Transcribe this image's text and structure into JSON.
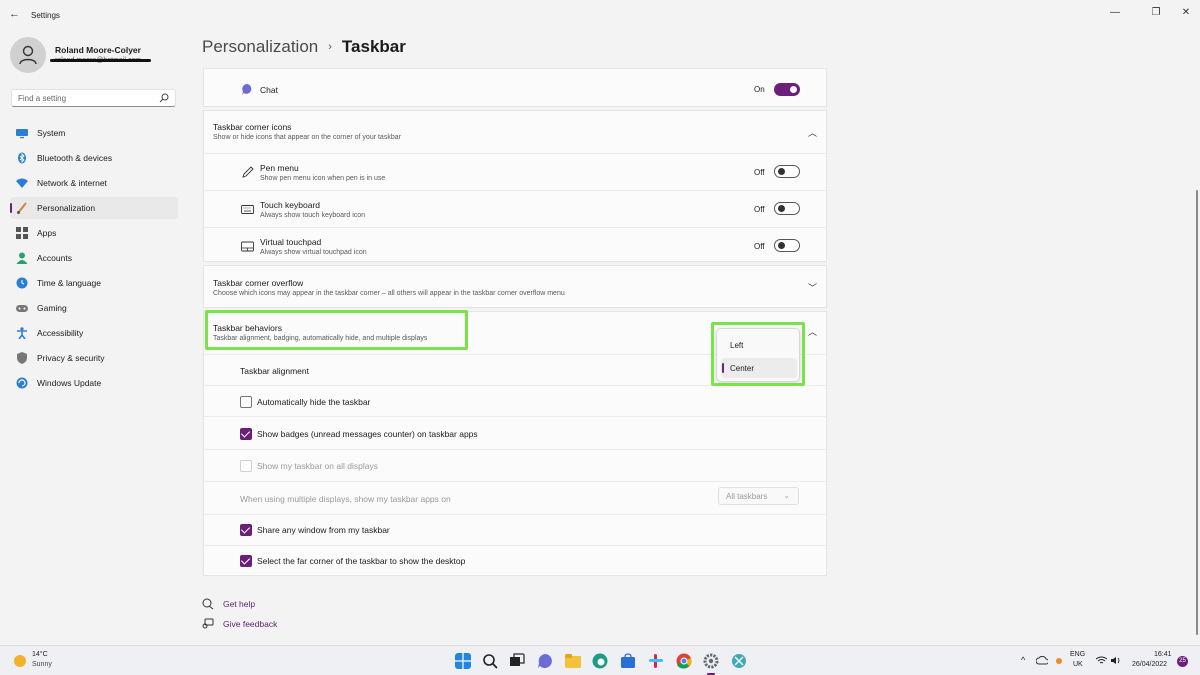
{
  "window": {
    "title": "Settings",
    "minimize_glyph": "—",
    "maximize_glyph": "❐",
    "close_glyph": "✕",
    "back_glyph": "←"
  },
  "profile": {
    "name": "Roland Moore-Colyer",
    "email": "roland.moore@hotmail.com"
  },
  "search": {
    "placeholder": "Find a setting"
  },
  "nav": {
    "items": [
      {
        "label": "System",
        "icon": "monitor-icon",
        "color": "#2a7fd4"
      },
      {
        "label": "Bluetooth & devices",
        "icon": "bluetooth-icon",
        "color": "#2a7fd4"
      },
      {
        "label": "Network & internet",
        "icon": "wifi-icon",
        "color": "#2a7fd4"
      },
      {
        "label": "Personalization",
        "icon": "brush-icon",
        "color": "#d8822f",
        "active": true
      },
      {
        "label": "Apps",
        "icon": "apps-icon",
        "color": "#555"
      },
      {
        "label": "Accounts",
        "icon": "person-icon",
        "color": "#2aa36a"
      },
      {
        "label": "Time & language",
        "icon": "globe-clock-icon",
        "color": "#2a7fd4"
      },
      {
        "label": "Gaming",
        "icon": "gamepad-icon",
        "color": "#777"
      },
      {
        "label": "Accessibility",
        "icon": "accessibility-icon",
        "color": "#2a7fd4"
      },
      {
        "label": "Privacy & security",
        "icon": "shield-icon",
        "color": "#777"
      },
      {
        "label": "Windows Update",
        "icon": "update-icon",
        "color": "#2a7fd4"
      }
    ]
  },
  "header": {
    "parent": "Personalization",
    "current": "Taskbar",
    "separator": "›"
  },
  "chat": {
    "label": "Chat",
    "state": "On"
  },
  "corner_icons": {
    "title": "Taskbar corner icons",
    "subtitle": "Show or hide icons that appear on the corner of your taskbar",
    "items": [
      {
        "label": "Pen menu",
        "desc": "Show pen menu icon when pen is in use",
        "state": "Off"
      },
      {
        "label": "Touch keyboard",
        "desc": "Always show touch keyboard icon",
        "state": "Off"
      },
      {
        "label": "Virtual touchpad",
        "desc": "Always show virtual touchpad icon",
        "state": "Off"
      }
    ]
  },
  "corner_overflow": {
    "title": "Taskbar corner overflow",
    "subtitle": "Choose which icons may appear in the taskbar corner – all others will appear in the taskbar corner overflow menu"
  },
  "behaviors": {
    "title": "Taskbar behaviors",
    "subtitle": "Taskbar alignment, badging, automatically hide, and multiple displays",
    "alignment_label": "Taskbar alignment",
    "alignment_options": [
      "Left",
      "Center"
    ],
    "alignment_selected": "Center",
    "auto_hide": "Automatically hide the taskbar",
    "show_badges": "Show badges (unread messages counter) on taskbar apps",
    "all_displays": "Show my taskbar on all displays",
    "multi_display_label": "When using multiple displays, show my taskbar apps on",
    "multi_display_value": "All taskbars",
    "share_window": "Share any window from my taskbar",
    "far_corner": "Select the far corner of the taskbar to show the desktop"
  },
  "links": {
    "help": "Get help",
    "feedback": "Give feedback"
  },
  "taskbar": {
    "weather_temp": "14°C",
    "weather_desc": "Sunny",
    "lang_1": "ENG",
    "lang_2": "UK",
    "time": "16:41",
    "date": "26/04/2022",
    "notifications": "25"
  },
  "colors": {
    "accent": "#6b1f7b",
    "highlight": "#7be34a"
  }
}
